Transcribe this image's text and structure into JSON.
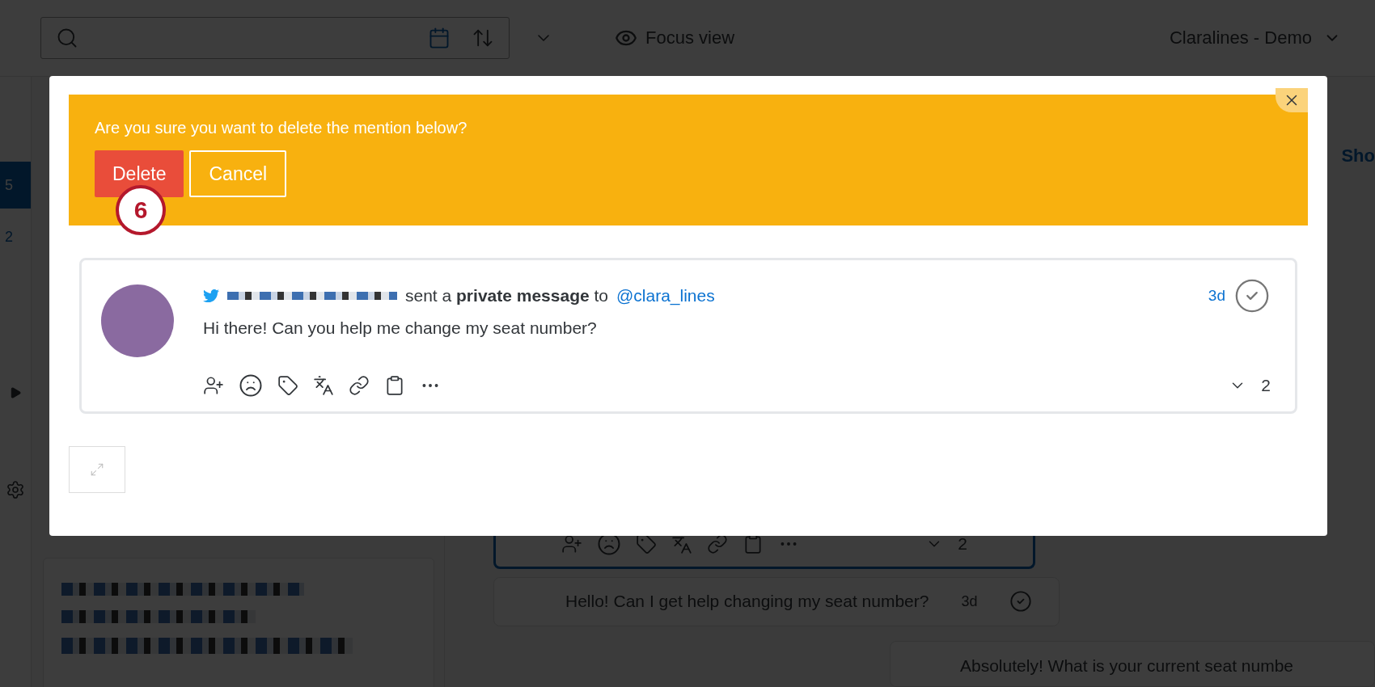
{
  "top_bar": {
    "focus_view": "Focus view",
    "account": "Claralines - Demo"
  },
  "sidebar": {
    "items": [
      {
        "label": "5",
        "selected": true
      },
      {
        "label": "2",
        "selected": false
      }
    ]
  },
  "panel_header": {
    "link": "Sho"
  },
  "conversation": {
    "reply_count": "2",
    "message": {
      "text": "Hello! Can I get help changing my seat number?",
      "time": "3d"
    },
    "reply": {
      "text": "Absolutely! What is your current seat numbe"
    }
  },
  "dialog": {
    "prompt": "Are you sure you want to delete the mention below?",
    "buttons": [
      {
        "label": "Delete",
        "kind": "danger"
      },
      {
        "label": "Cancel",
        "kind": "outline"
      }
    ],
    "step_badge": "6",
    "mention": {
      "action": "sent a **private message** to",
      "handle": "@clara_lines",
      "time": "3d",
      "text": "Hi there! Can you help me change my seat number?",
      "reply_count": "2"
    }
  }
}
